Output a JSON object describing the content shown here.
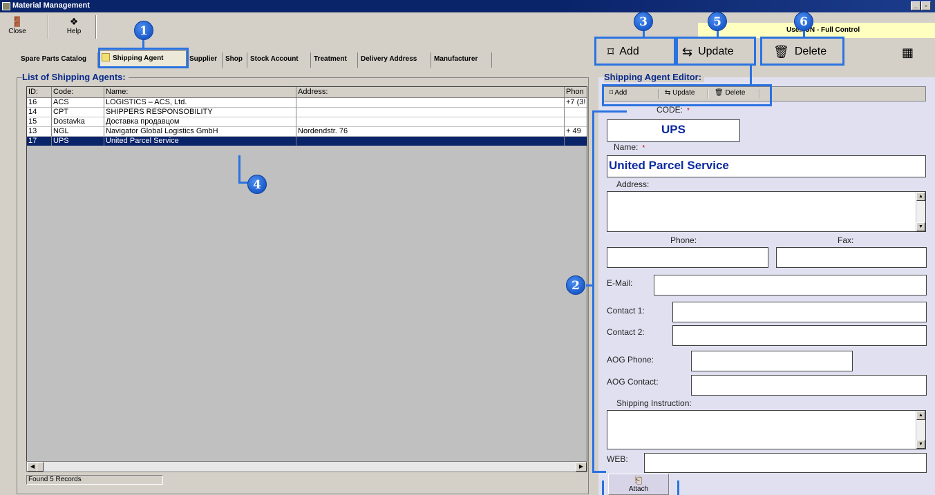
{
  "window": {
    "title": "Material Management"
  },
  "toolbar": {
    "close_label": "Close",
    "help_label": "Help"
  },
  "user_banner": "Use...UN - Full Control",
  "tabs": [
    {
      "label": "Spare Parts Catalog"
    },
    {
      "label": "Shipping Agent",
      "active": true
    },
    {
      "label": "Supplier"
    },
    {
      "label": "Shop"
    },
    {
      "label": "Stock Account"
    },
    {
      "label": "Treatment"
    },
    {
      "label": "Delivery Address"
    },
    {
      "label": "Manufacturer"
    }
  ],
  "list": {
    "title": "List of Shipping Agents:",
    "columns": [
      "ID:",
      "Code:",
      "Name:",
      "Address:",
      "Phon"
    ],
    "rows": [
      {
        "id": "16",
        "code": "ACS",
        "name": "LOGISTICS – ACS, Ltd.",
        "address": "",
        "phone": "+7 (3!"
      },
      {
        "id": "14",
        "code": "CPT",
        "name": "SHIPPERS RESPONSOBILITY",
        "address": "",
        "phone": ""
      },
      {
        "id": "15",
        "code": "Dostavka",
        "name": "Доставка продавцом",
        "address": "",
        "phone": ""
      },
      {
        "id": "13",
        "code": "NGL",
        "name": "Navigator Global Logistics GmbH",
        "address": "Nordendstr. 76",
        "phone": "+ 49"
      },
      {
        "id": "17",
        "code": "UPS",
        "name": "United Parcel Service",
        "address": "",
        "phone": "",
        "selected": true
      }
    ],
    "status": "Found 5 Records"
  },
  "actions": {
    "add_label": "Add",
    "update_label": "Update",
    "delete_label": "Delete"
  },
  "editor": {
    "title": "Shipping Agent Editor:",
    "toolbar": {
      "add": "Add",
      "update": "Update",
      "delete": "Delete"
    },
    "code_label": "CODE:",
    "code_value": "UPS",
    "name_label": "Name:",
    "name_value": "United Parcel Service",
    "address_label": "Address:",
    "phone_label": "Phone:",
    "fax_label": "Fax:",
    "email_label": "E-Mail:",
    "contact1_label": "Contact 1:",
    "contact2_label": "Contact 2:",
    "aog_phone_label": "AOG Phone:",
    "aog_contact_label": "AOG Contact:",
    "shipping_instruction_label": "Shipping Instruction:",
    "web_label": "WEB:",
    "required_mark": "*",
    "attach_label": "Attach"
  },
  "callouts": [
    "1",
    "2",
    "3",
    "4",
    "5",
    "6"
  ]
}
